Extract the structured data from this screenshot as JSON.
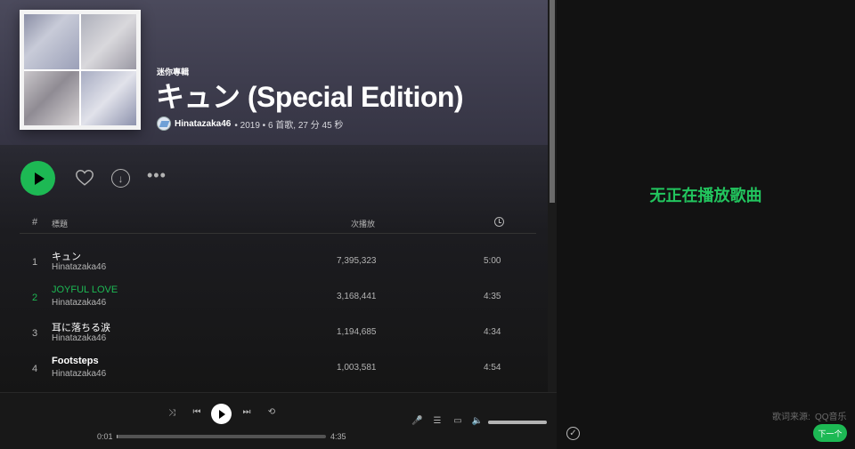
{
  "album": {
    "type_label": "迷你專輯",
    "title": "キュン (Special Edition)",
    "artist": "Hinatazaka46",
    "details": "• 2019 • 6 首歌, 27 分 45 秒"
  },
  "actions": {
    "more_label": "•••"
  },
  "table": {
    "headers": {
      "number": "#",
      "title": "標題",
      "plays": "次播放"
    },
    "rows": [
      {
        "num": "1",
        "title": "キュン",
        "artist": "Hinatazaka46",
        "plays": "7,395,323",
        "duration": "5:00"
      },
      {
        "num": "2",
        "title": "JOYFUL LOVE",
        "artist": "Hinatazaka46",
        "plays": "3,168,441",
        "duration": "4:35"
      },
      {
        "num": "3",
        "title": "耳に落ちる涙",
        "artist": "Hinatazaka46",
        "plays": "1,194,685",
        "duration": "4:34"
      },
      {
        "num": "4",
        "title": "Footsteps",
        "artist": "Hinatazaka46",
        "plays": "1,003,581",
        "duration": "4:54"
      }
    ]
  },
  "player": {
    "current_time": "0:01",
    "total_time": "4:35",
    "progress_fraction": 0.004,
    "volume_fraction": 1.0
  },
  "lyrics_panel": {
    "no_song": "无正在播放歌曲",
    "source_label": "歌词来源:",
    "source_name": "QQ音乐",
    "next_label": "下一个"
  },
  "colors": {
    "accent": "#1db954",
    "header_bg": "#4b4a5c",
    "background": "#121212"
  }
}
